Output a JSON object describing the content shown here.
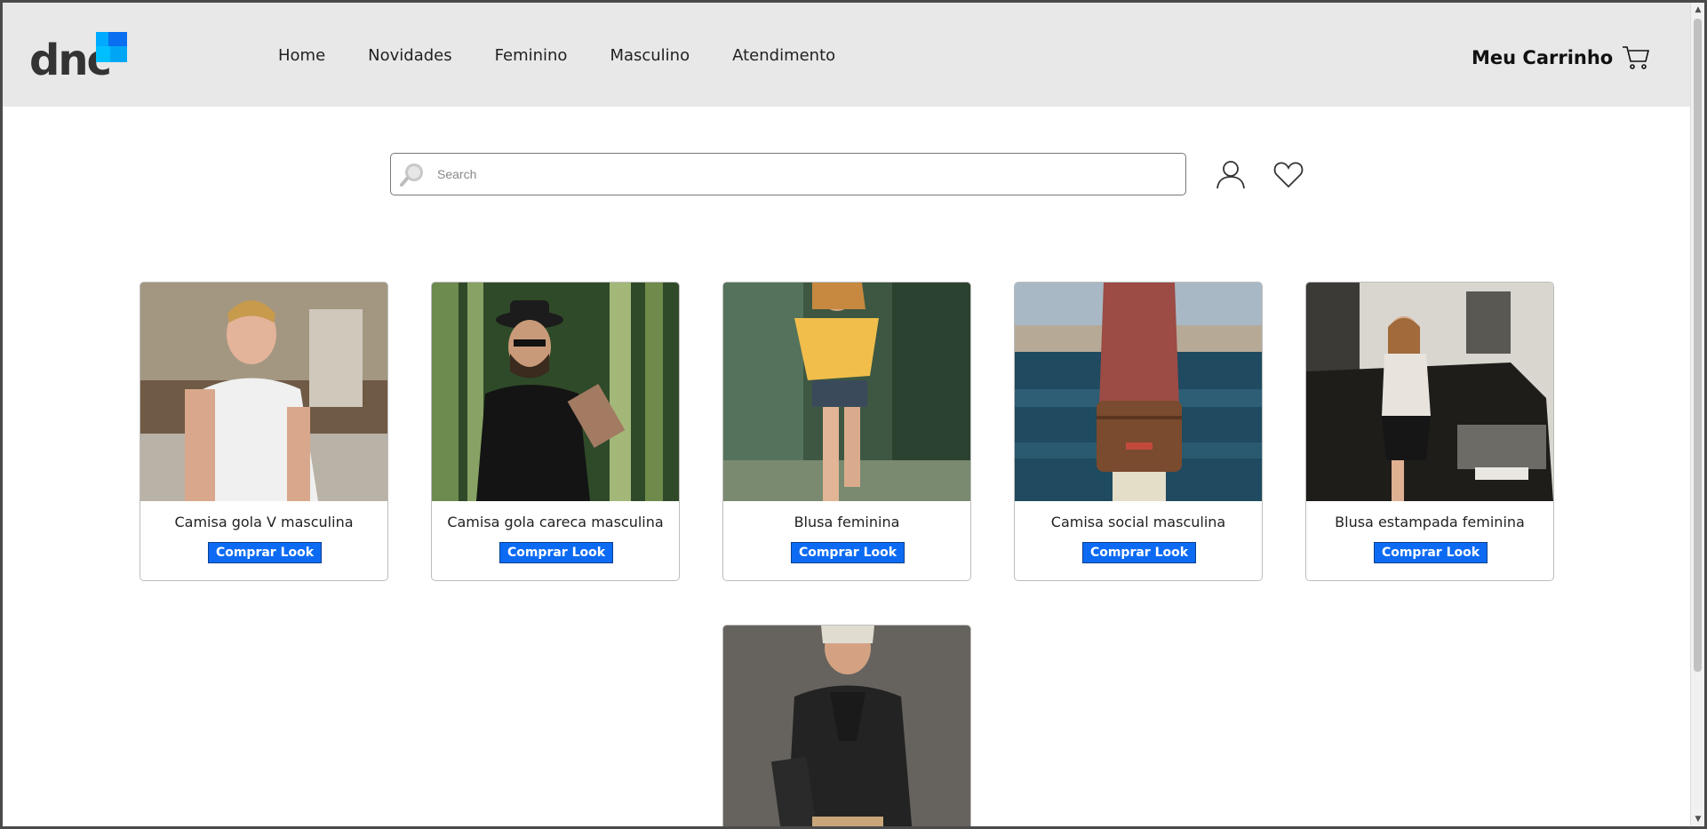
{
  "brand": {
    "logo_text": "dnc"
  },
  "nav": {
    "items": [
      {
        "label": "Home"
      },
      {
        "label": "Novidades"
      },
      {
        "label": "Feminino"
      },
      {
        "label": "Masculino"
      },
      {
        "label": "Atendimento"
      }
    ]
  },
  "cart": {
    "label": "Meu Carrinho"
  },
  "search": {
    "placeholder": "Search",
    "value": ""
  },
  "products": [
    {
      "name": "Camisa gola V masculina",
      "button": "Comprar Look"
    },
    {
      "name": "Camisa gola careca masculina",
      "button": "Comprar Look"
    },
    {
      "name": "Blusa feminina",
      "button": "Comprar Look"
    },
    {
      "name": "Camisa social masculina",
      "button": "Comprar Look"
    },
    {
      "name": "Blusa estampada feminina",
      "button": "Comprar Look"
    }
  ],
  "colors": {
    "header_bg": "#e8e8e8",
    "button_bg": "#0d6bf3",
    "logo_blue": "#00aaff"
  },
  "icons": [
    "search-icon",
    "user-icon",
    "heart-icon",
    "cart-icon"
  ]
}
